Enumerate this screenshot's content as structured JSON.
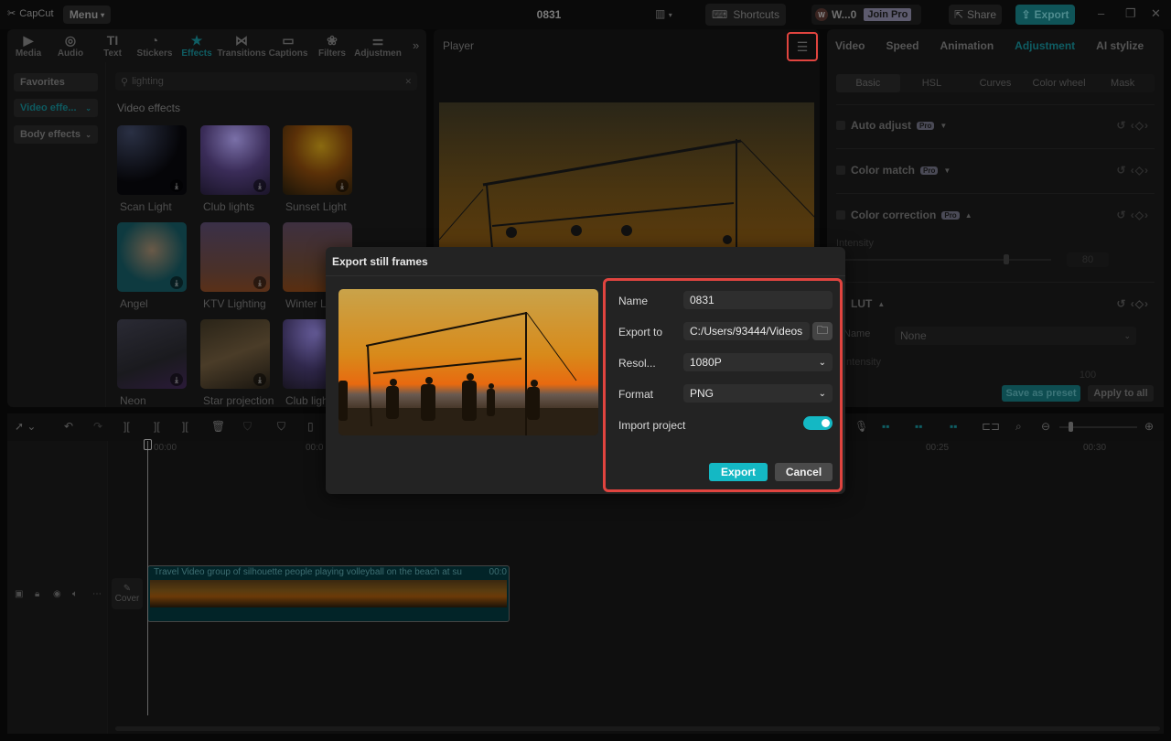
{
  "app": {
    "name": "CapCut",
    "menu_label": "Menu",
    "project_title": "0831"
  },
  "titlebar": {
    "shortcuts_label": "Shortcuts",
    "user_initial": "W",
    "user_name": "W...0",
    "join_pro_label": "Join Pro",
    "share_label": "Share",
    "export_label": "Export"
  },
  "tool_tabs": [
    {
      "label": "Media",
      "icon": "media-icon"
    },
    {
      "label": "Audio",
      "icon": "audio-icon"
    },
    {
      "label": "Text",
      "icon": "text-icon"
    },
    {
      "label": "Stickers",
      "icon": "stickers-icon"
    },
    {
      "label": "Effects",
      "icon": "effects-icon",
      "active": true
    },
    {
      "label": "Transitions",
      "icon": "transitions-icon"
    },
    {
      "label": "Captions",
      "icon": "captions-icon"
    },
    {
      "label": "Filters",
      "icon": "filters-icon"
    },
    {
      "label": "Adjustmen",
      "icon": "adjustment-icon"
    }
  ],
  "effects_panel": {
    "categories": [
      {
        "label": "Favorites"
      },
      {
        "label": "Video effe...",
        "active": true
      },
      {
        "label": "Body effects"
      }
    ],
    "search_value": "lighting",
    "section_title": "Video effects",
    "items": [
      {
        "label": "Scan Light"
      },
      {
        "label": "Club lights"
      },
      {
        "label": "Sunset Light"
      },
      {
        "label": "Angel"
      },
      {
        "label": "KTV Lighting"
      },
      {
        "label": "Winter L"
      },
      {
        "label": "Neon"
      },
      {
        "label": "Star projection"
      },
      {
        "label": "Club ligh"
      }
    ]
  },
  "player": {
    "title": "Player"
  },
  "right_panel": {
    "tabs": [
      {
        "label": "Video"
      },
      {
        "label": "Speed"
      },
      {
        "label": "Animation"
      },
      {
        "label": "Adjustment",
        "active": true
      },
      {
        "label": "AI stylize"
      }
    ],
    "subtabs": [
      {
        "label": "Basic",
        "active": true
      },
      {
        "label": "HSL"
      },
      {
        "label": "Curves"
      },
      {
        "label": "Color wheel"
      },
      {
        "label": "Mask"
      }
    ],
    "rows": [
      {
        "label": "Auto adjust",
        "badge": "Pro"
      },
      {
        "label": "Color match",
        "badge": "Pro"
      },
      {
        "label": "Color correction",
        "badge": "Pro"
      }
    ],
    "intensity_label": "Intensity",
    "intensity_value": "80",
    "lut_label": "LUT",
    "lut_name_label": "Name",
    "lut_name_value": "None",
    "lut_intensity_label": "Intensity",
    "lut_intensity_value": "100",
    "save_preset_label": "Save as preset",
    "apply_all_label": "Apply to all"
  },
  "timeline": {
    "ruler": [
      "00:00",
      "00:0",
      "00:25",
      "00:30"
    ],
    "clip_title": "Travel Video group of silhouette people playing volleyball on the beach at su",
    "clip_time": "00:0",
    "cover_label": "Cover"
  },
  "dialog": {
    "title": "Export still frames",
    "name_label": "Name",
    "name_value": "0831",
    "export_to_label": "Export to",
    "export_to_value": "C:/Users/93444/Videos...",
    "resolution_label": "Resol...",
    "resolution_value": "1080P",
    "format_label": "Format",
    "format_value": "PNG",
    "import_project_label": "Import project",
    "import_project_on": true,
    "export_label": "Export",
    "cancel_label": "Cancel"
  },
  "colors": {
    "accent": "#14b8c4",
    "highlight": "#e0443f"
  }
}
